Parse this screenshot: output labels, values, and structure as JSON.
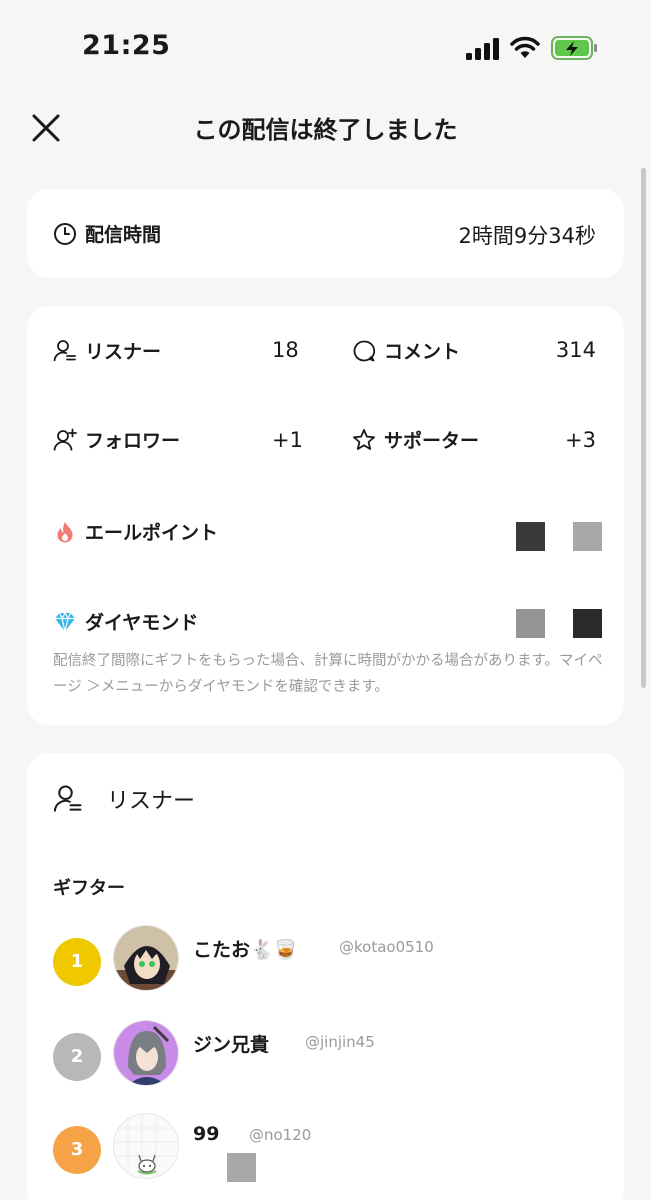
{
  "status_bar": {
    "time": "21:25"
  },
  "header": {
    "title": "この配信は終了しました"
  },
  "duration": {
    "label": "配信時間",
    "value": "2時間9分34秒"
  },
  "stats": {
    "listeners": {
      "label": "リスナー",
      "value": "18"
    },
    "comments": {
      "label": "コメント",
      "value": "314"
    },
    "followers": {
      "label": "フォロワー",
      "value": "+1"
    },
    "supporters": {
      "label": "サポーター",
      "value": "+3"
    },
    "ale_points": {
      "label": "エールポイント"
    },
    "diamonds": {
      "label": "ダイヤモンド"
    },
    "note": "配信終了間際にギフトをもらった場合、計算に時間がかかる場合があります。マイページ ＞メニューからダイヤモンドを確認できます。"
  },
  "listeners_section": {
    "title": "リスナー",
    "gifter_heading": "ギフター",
    "gifters": [
      {
        "rank": "1",
        "name": "こたお🐇🥃",
        "handle": "@kotao0510",
        "badge_color": "#f0c800"
      },
      {
        "rank": "2",
        "name": "ジン兄貴",
        "handle": "@jinjin45",
        "badge_color": "#b8b8b8"
      },
      {
        "rank": "3",
        "name": "99",
        "handle": "@no120",
        "badge_color": "#f5a346"
      }
    ]
  },
  "icons": {
    "close": "close-icon",
    "clock": "clock-icon",
    "listener": "person-icon",
    "comment": "speech-bubble-icon",
    "follower": "person-plus-icon",
    "supporter": "star-icon",
    "ale": "flame-icon",
    "diamond": "diamond-icon"
  }
}
